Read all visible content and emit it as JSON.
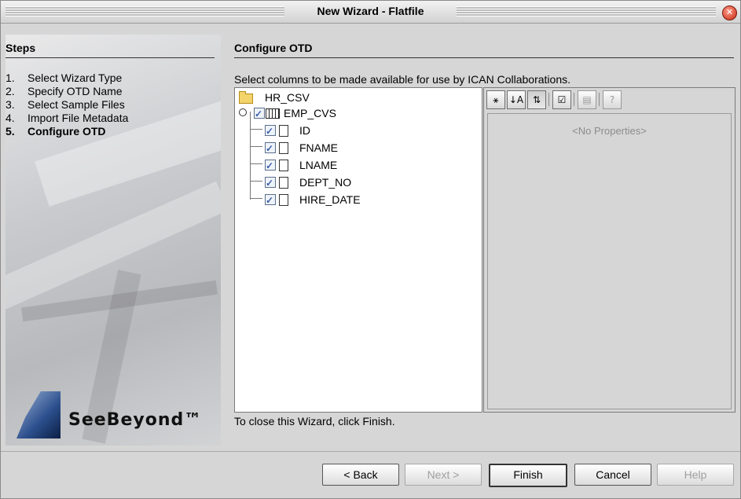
{
  "window": {
    "title": "New Wizard - Flatfile"
  },
  "steps": {
    "header": "Steps",
    "items": [
      {
        "num": "1.",
        "label": "Select Wizard Type"
      },
      {
        "num": "2.",
        "label": "Specify OTD Name"
      },
      {
        "num": "3.",
        "label": "Select Sample Files"
      },
      {
        "num": "4.",
        "label": "Import File Metadata"
      },
      {
        "num": "5.",
        "label": "Configure OTD"
      }
    ],
    "current_index": 4,
    "logo_text": "SeeBeyond™"
  },
  "main": {
    "header": "Configure OTD",
    "instruction": "Select columns to be made available for use by ICAN Collaborations.",
    "tree": {
      "root": {
        "label": "HR_CSV",
        "icon": "folder-icon"
      },
      "table": {
        "label": "EMP_CVS",
        "icon": "table-icon",
        "checked": true
      },
      "columns": [
        {
          "label": "ID",
          "checked": true
        },
        {
          "label": "FNAME",
          "checked": true
        },
        {
          "label": "LNAME",
          "checked": true
        },
        {
          "label": "DEPT_NO",
          "checked": true
        },
        {
          "label": "HIRE_DATE",
          "checked": true
        }
      ]
    },
    "properties": {
      "toolbar": [
        {
          "name": "expand-icon",
          "glyph": "⚹"
        },
        {
          "name": "sort-icon",
          "glyph": "↓A"
        },
        {
          "name": "categorized-icon",
          "glyph": "⇅"
        },
        {
          "name": "edit-list-icon",
          "glyph": "☑"
        },
        {
          "name": "description-icon",
          "glyph": "▤"
        },
        {
          "name": "help-icon",
          "glyph": "?"
        }
      ],
      "empty_text": "<No Properties>"
    },
    "close_hint": "To close this Wizard, click Finish."
  },
  "buttons": {
    "back": "< Back",
    "next": "Next >",
    "finish": "Finish",
    "cancel": "Cancel",
    "help": "Help"
  }
}
